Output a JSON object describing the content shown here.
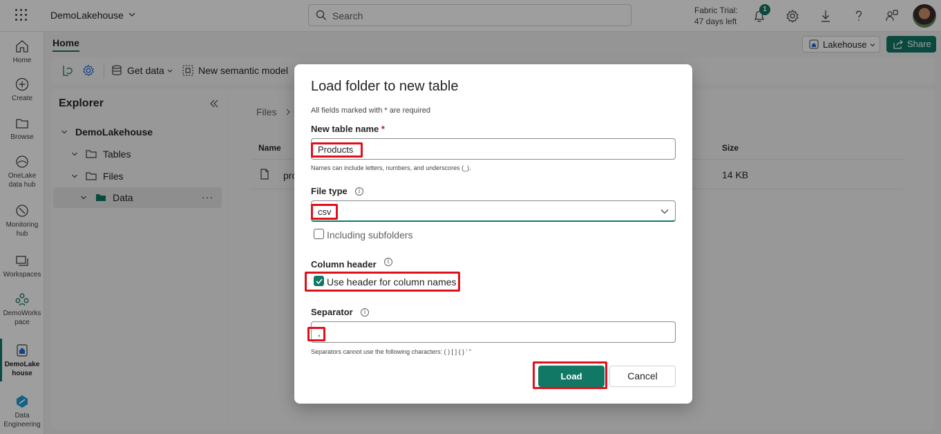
{
  "topbar": {
    "workspace_name": "DemoLakehouse",
    "search_placeholder": "Search",
    "trial_line1": "Fabric Trial:",
    "trial_line2": "47 days left",
    "notification_count": "1"
  },
  "rail": {
    "items": [
      {
        "label": "Home"
      },
      {
        "label": "Create"
      },
      {
        "label": "Browse"
      },
      {
        "label": "OneLake data hub"
      },
      {
        "label": "Monitoring hub"
      },
      {
        "label": "Workspaces"
      },
      {
        "label": "DemoWorkspace"
      },
      {
        "label": "DemoLakehouse"
      },
      {
        "label": "Data Engineering"
      }
    ]
  },
  "header": {
    "tab_home": "Home",
    "lakehouse_button": "Lakehouse",
    "share_button": "Share"
  },
  "ribbon": {
    "get_data": "Get data",
    "new_semantic_model": "New semantic model"
  },
  "explorer": {
    "title": "Explorer",
    "tree": {
      "root": "DemoLakehouse",
      "tables": "Tables",
      "files": "Files",
      "data": "Data",
      "more": "···"
    }
  },
  "main": {
    "breadcrumb": "Files",
    "col_name": "Name",
    "col_size": "Size",
    "file_name": "pro",
    "file_size": "14 KB"
  },
  "dialog": {
    "title": "Load folder to new table",
    "required_note": "All fields marked with * are required",
    "table_name_label": "New table name",
    "required_star": "*",
    "table_name_value": "Products",
    "table_name_hint": "Names can include letters, numbers, and underscores (_).",
    "file_type_label": "File type",
    "file_type_value": "csv",
    "subfolders_label": "Including subfolders",
    "column_header_label": "Column header",
    "use_header_label": "Use header for column names",
    "separator_label": "Separator",
    "separator_value": ",",
    "separator_hint": "Separators cannot use the following characters: ( ) [ ] { } ' \"",
    "load_button": "Load",
    "cancel_button": "Cancel"
  },
  "colors": {
    "accent": "#117865",
    "highlight": "#e0101a"
  }
}
